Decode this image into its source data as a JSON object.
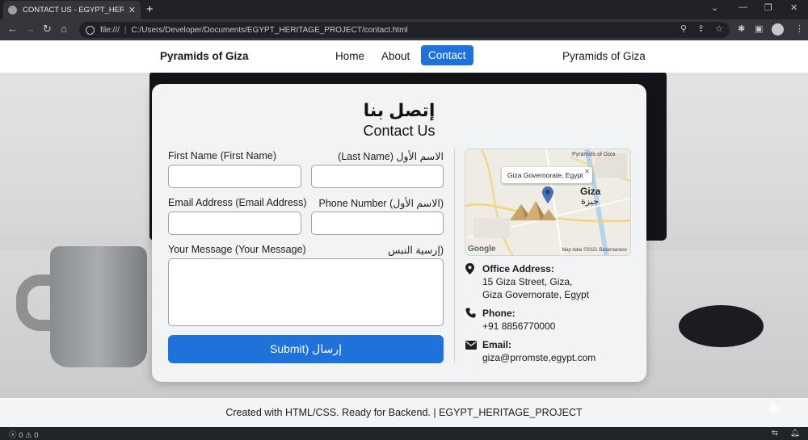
{
  "browser": {
    "tab_title": "CONTACT US - EGYPT_HERITAGE",
    "new_tab": "+",
    "url_scheme": "file:///",
    "url_path": "C:/Users/Developer/Documents/EGYPT_HERITAGE_PROJECT/contact.html"
  },
  "nav": {
    "brand": "Pyramids of Giza",
    "links": [
      "Home",
      "About",
      "Contact"
    ],
    "active": "Contact",
    "right_brand": "Pyramids of Giza"
  },
  "contact": {
    "title_ar": "إتصل بنا",
    "title_en": "Contact Us",
    "first_name_label": "First Name (First Name)",
    "last_name_label": "(Last Name) الاسم الأول",
    "email_label": "Email Address (Email Address)",
    "phone_label": "Phone Number (الاسم الأول)",
    "message_label": "Your Message (Your Message)",
    "message_label_ar": "إرسية النبس)",
    "first_name_value": "",
    "last_name_value": "",
    "email_value": "",
    "phone_value": "",
    "message_value": "",
    "submit_label": "Submit) إرسال"
  },
  "map": {
    "popup": "Giza Governorate, Egypt",
    "city": "Giza",
    "city_ar": "جيزة",
    "pyramids_label": "Pyramids of Giza",
    "google": "Google",
    "credits": "Map data ©2021 Basemaness"
  },
  "info": {
    "address_heading": "Office Address:",
    "address_line1": "15 Giza Street, Giza,",
    "address_line2": "Giza Governorate, Egypt",
    "phone_heading": "Phone:",
    "phone_value": "+91 8856770000",
    "email_heading": "Email:",
    "email_value": "giza@prromste,egypt.com"
  },
  "footer": {
    "text": "Created with HTML/CSS. Ready for Backend. | EGYPT_HERITAGE_PROJECT"
  },
  "statusbar": {
    "errors": "0",
    "warnings": "0"
  },
  "colors": {
    "accent": "#1e72d9",
    "chrome_dark": "#35363a",
    "card_bg": "#f2f3f4"
  },
  "icons": [
    "globe-icon",
    "close-icon",
    "back-icon",
    "forward-icon",
    "reload-icon",
    "home-icon",
    "info-icon",
    "zoom-icon",
    "share-icon",
    "star-icon",
    "extensions-icon",
    "sidepanel-icon",
    "profile-icon",
    "menu-icon",
    "location-pin-icon",
    "phone-icon",
    "mail-icon",
    "error-icon",
    "warning-icon",
    "notification-icon",
    "bell-icon"
  ]
}
